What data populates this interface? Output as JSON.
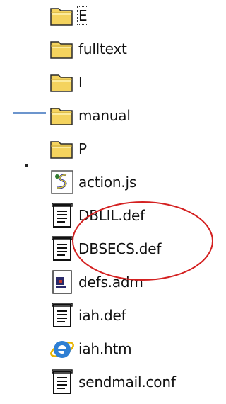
{
  "files": [
    {
      "label": "E",
      "icon": "folder-icon",
      "focused": true
    },
    {
      "label": "fulltext",
      "icon": "folder-icon",
      "focused": false
    },
    {
      "label": "I",
      "icon": "folder-icon",
      "focused": false
    },
    {
      "label": "manual",
      "icon": "folder-icon",
      "focused": false
    },
    {
      "label": "P",
      "icon": "folder-icon",
      "focused": false
    },
    {
      "label": "action.js",
      "icon": "script-file-icon",
      "focused": false
    },
    {
      "label": "DBLIL.def",
      "icon": "text-file-icon",
      "focused": false
    },
    {
      "label": "DBSECS.def",
      "icon": "text-file-icon",
      "focused": false
    },
    {
      "label": "defs.adm",
      "icon": "adm-file-icon",
      "focused": false
    },
    {
      "label": "iah.def",
      "icon": "text-file-icon",
      "focused": false
    },
    {
      "label": "iah.htm",
      "icon": "internet-explorer-icon",
      "focused": false
    },
    {
      "label": "sendmail.conf",
      "icon": "text-file-icon",
      "focused": false
    }
  ],
  "colors": {
    "highlight_ellipse": "#d42020",
    "tree_line": "#6c95cd",
    "folder_fill": "#f4d35e",
    "folder_outline": "#2a2a2a"
  }
}
